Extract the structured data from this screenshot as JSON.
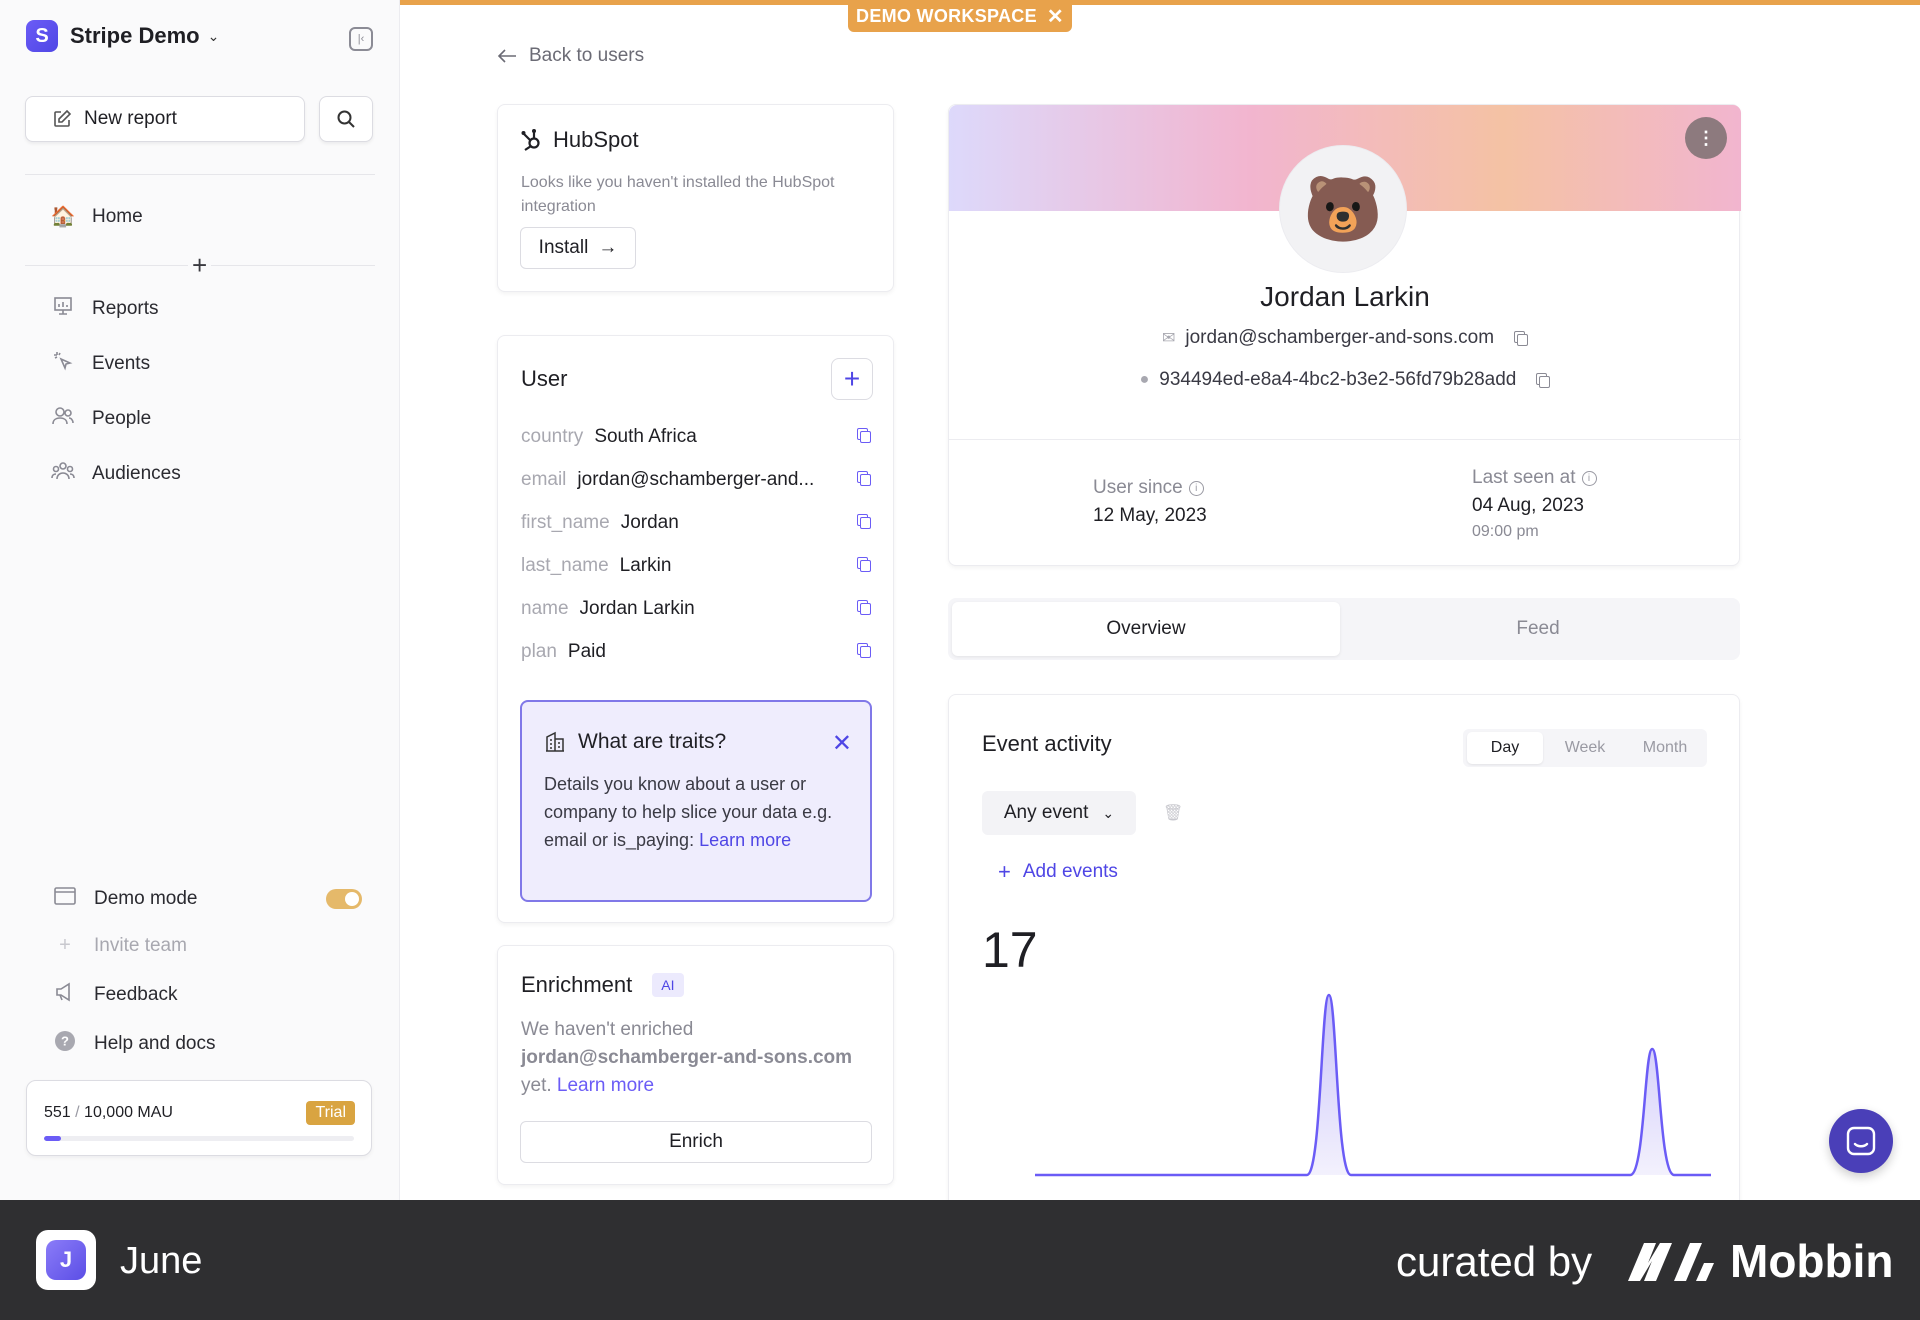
{
  "sidebar": {
    "workspace_name": "Stripe Demo",
    "workspace_initial": "S",
    "new_report_label": "New report",
    "nav": [
      {
        "label": "Home",
        "icon": "home-icon"
      },
      {
        "label": "Reports",
        "icon": "reports-icon"
      },
      {
        "label": "Events",
        "icon": "events-icon"
      },
      {
        "label": "People",
        "icon": "people-icon"
      },
      {
        "label": "Audiences",
        "icon": "audiences-icon"
      }
    ],
    "bottom": [
      {
        "label": "Demo mode",
        "icon": "window-icon"
      },
      {
        "label": "Invite team",
        "icon": "plus-icon"
      },
      {
        "label": "Feedback",
        "icon": "megaphone-icon"
      },
      {
        "label": "Help and docs",
        "icon": "help-icon"
      }
    ],
    "demo_mode_on": true,
    "mau": {
      "used": "551",
      "total": "10,000 MAU",
      "badge": "Trial",
      "fraction": 0.0551
    }
  },
  "banner": {
    "label": "DEMO WORKSPACE",
    "color": "#e8a24b"
  },
  "back_label": "Back to users",
  "hubspot": {
    "title": "HubSpot",
    "description": "Looks like you haven't installed the HubSpot integration",
    "install_label": "Install"
  },
  "user_card": {
    "title": "User",
    "traits": [
      {
        "key": "country",
        "value": "South Africa"
      },
      {
        "key": "email",
        "value": "jordan@schamberger-and..."
      },
      {
        "key": "first_name",
        "value": "Jordan"
      },
      {
        "key": "last_name",
        "value": "Larkin"
      },
      {
        "key": "name",
        "value": "Jordan Larkin"
      },
      {
        "key": "plan",
        "value": "Paid"
      }
    ],
    "info": {
      "title": "What are traits?",
      "body": "Details you know about a user or company to help slice your data e.g. email or is_paying: ",
      "link": "Learn more"
    }
  },
  "enrichment": {
    "title": "Enrichment",
    "badge": "AI",
    "body_prefix": "We haven't enriched",
    "email": "jordan@schamberger-and-sons.com",
    "body_suffix": "yet.",
    "link": "Learn more",
    "button": "Enrich"
  },
  "profile": {
    "avatar": "🐻",
    "name": "Jordan Larkin",
    "email": "jordan@schamberger-and-sons.com",
    "id": "934494ed-e8a4-4bc2-b3e2-56fd79b28add",
    "user_since_label": "User since",
    "user_since": "12 May, 2023",
    "last_seen_label": "Last seen at",
    "last_seen_date": "04 Aug, 2023",
    "last_seen_time": "09:00 pm"
  },
  "tabs": [
    {
      "label": "Overview",
      "active": true
    },
    {
      "label": "Feed",
      "active": false
    }
  ],
  "event_activity": {
    "title": "Event activity",
    "periods": [
      {
        "label": "Day",
        "active": true
      },
      {
        "label": "Week",
        "active": false
      },
      {
        "label": "Month",
        "active": false
      }
    ],
    "event_select": "Any event",
    "add_events": "Add events",
    "total": "17"
  },
  "chart_data": {
    "type": "area",
    "series": [
      {
        "values": [
          0,
          0,
          0,
          0,
          0,
          0,
          0,
          0,
          0,
          0,
          10,
          0,
          0,
          0,
          0,
          0,
          0,
          0,
          0,
          0,
          0,
          7,
          0,
          0
        ]
      }
    ],
    "color": "#6b5cf6"
  },
  "footer": {
    "app_name": "June",
    "curated_by": "curated by",
    "brand": "Mobbin"
  }
}
